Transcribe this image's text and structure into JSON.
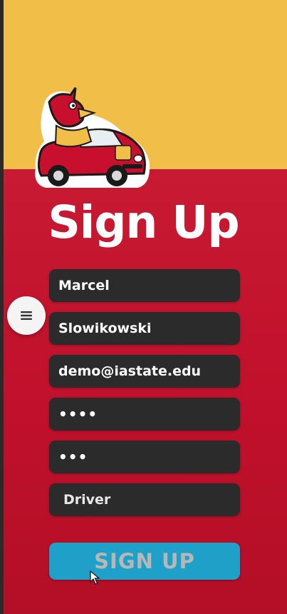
{
  "header": {
    "title": "Sign Up"
  },
  "form": {
    "first_name": "Marcel",
    "last_name": "Slowikowski",
    "email": "demo@iastate.edu",
    "password": "••••",
    "confirm_password": "•••",
    "role": "Driver",
    "submit_label": "SIGN UP"
  },
  "colors": {
    "top_band": "#f1be48",
    "bottom_band": "#c8102e",
    "field_bg": "#2b2b2b",
    "submit_bg": "#1ea0c8"
  },
  "icons": [
    "cardinal-driving-car-mascot",
    "hamburger-menu-icon",
    "mouse-cursor-icon"
  ]
}
